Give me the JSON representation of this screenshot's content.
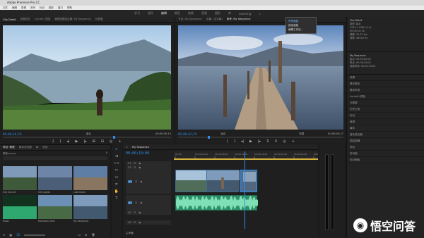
{
  "app": {
    "title": "Adobe Premiere Pro CC"
  },
  "menubar": [
    "文件",
    "编辑",
    "剪辑",
    "序列",
    "标记",
    "图形",
    "窗口",
    "帮助"
  ],
  "workspace_tabs": [
    {
      "label": "学习",
      "active": false
    },
    {
      "label": "组件",
      "active": false
    },
    {
      "label": "编辑",
      "active": true
    },
    {
      "label": "颜色",
      "active": false
    },
    {
      "label": "效果",
      "active": false
    },
    {
      "label": "音频",
      "active": false
    },
    {
      "label": "图形",
      "active": false
    },
    {
      "label": "库",
      "active": false
    },
    {
      "label": "Learning",
      "active": false
    }
  ],
  "dropdown": {
    "items": [
      "所有面板",
      "锁定面板",
      "编辑工作区..."
    ]
  },
  "source_monitor": {
    "tabs": [
      "Clip Detail",
      "效果控件",
      "Lumetri 范围",
      "音频剪辑混合器: My Sequence",
      "元数据"
    ],
    "timecode_in": "00;00;10;18",
    "fit": "适合",
    "timecode_out": "00;00;05;15"
  },
  "program_monitor": {
    "tabs": [
      "节目: My Sequence",
      "字幕: (无字幕)",
      "参考: My Sequence"
    ],
    "timecode_in": "00;00;03;29",
    "fit": "适合",
    "full": "完整",
    "timecode_out": "00;00;05;17"
  },
  "project_panel": {
    "tabs": [
      "项目: 教程",
      "媒体浏览器",
      "库",
      "信息"
    ],
    "project_name": "教程.prproj",
    "item_count": "8",
    "items": [
      {
        "name": "City Sunset"
      },
      {
        "name": "City Lights"
      },
      {
        "name": "Lake Dock"
      },
      {
        "name": "Music"
      },
      {
        "name": "Mountain View"
      },
      {
        "name": "My Sequence"
      }
    ]
  },
  "timeline": {
    "tab": "My Sequence",
    "timecode": "00;00;10;08",
    "ruler_ticks": [
      "00;00",
      "00;00;04;00",
      "00;00;08;00",
      "00;00;12;00",
      "00;00;16;00",
      "00;00;20;00",
      "00;00;24;00",
      "00;00;28;00"
    ],
    "tracks": [
      "V3",
      "V2",
      "V1",
      "A1",
      "A2",
      "A3"
    ],
    "master": "主声道"
  },
  "right_panel": {
    "info_title": "Clip Detail",
    "info_lines": [
      "类型: 影片",
      "1920 x 1080 (1.0)",
      "00;00;10;18",
      "视频: 29.97 fps",
      "音频: 48000 Hz"
    ],
    "sequence_title": "My Sequence",
    "seq_lines": [
      "起点: 00;00;00;00",
      "终点: 00;00;23;04",
      "持续时间: 00;00;23;05"
    ],
    "items": [
      "效果",
      "基本图形",
      "基本声音",
      "Lumetri 颜色",
      "元数据",
      "历史记录",
      "标记",
      "音频",
      "事件",
      "音轨混合器",
      "源监视器",
      "项目",
      "时间轴",
      "标记面板"
    ]
  },
  "bottom_left": {
    "zoom_label": "15"
  },
  "watermark": "悟空问答",
  "colors": {
    "accent_blue": "#2d8ceb",
    "video_clip": "#4b7fa8",
    "audio_clip": "#2f8f6a",
    "timeline_yellow": "#d8b33a"
  }
}
